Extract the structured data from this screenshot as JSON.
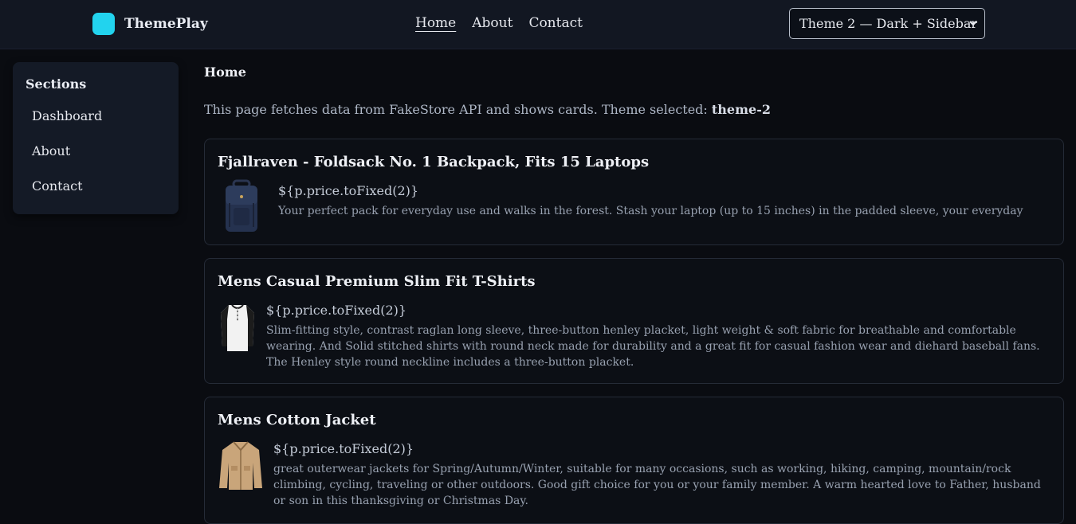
{
  "brand": {
    "name": "ThemePlay",
    "logo_color": "#22d3ee"
  },
  "nav": {
    "home": "Home",
    "about": "About",
    "contact": "Contact"
  },
  "theme_select": {
    "selected": "Theme 2 — Dark + Sidebar",
    "icon": "chevron-down-icon"
  },
  "sidebar": {
    "title": "Sections",
    "items": [
      {
        "label": "Dashboard"
      },
      {
        "label": "About"
      },
      {
        "label": "Contact"
      }
    ]
  },
  "main": {
    "title": "Home",
    "intro_text": "This page fetches data from FakeStore API and shows cards. Theme selected: ",
    "intro_theme": "theme-2"
  },
  "products": [
    {
      "title": "Fjallraven - Foldsack No. 1 Backpack, Fits 15 Laptops",
      "price": "${p.price.toFixed(2)}",
      "description": "Your perfect pack for everyday use and walks in the forest. Stash your laptop (up to 15 inches) in the padded sleeve, your everyday",
      "image": "backpack-image"
    },
    {
      "title": "Mens Casual Premium Slim Fit T-Shirts",
      "price": "${p.price.toFixed(2)}",
      "description": "Slim-fitting style, contrast raglan long sleeve, three-button henley placket, light weight & soft fabric for breathable and comfortable wearing. And Solid stitched shirts with round neck made for durability and a great fit for casual fashion wear and diehard baseball fans. The Henley style round neckline includes a three-button placket.",
      "image": "tshirt-image"
    },
    {
      "title": "Mens Cotton Jacket",
      "price": "${p.price.toFixed(2)}",
      "description": "great outerwear jackets for Spring/Autumn/Winter, suitable for many occasions, such as working, hiking, camping, mountain/rock climbing, cycling, traveling or other outdoors. Good gift choice for you or your family member. A warm hearted love to Father, husband or son in this thanksgiving or Christmas Day.",
      "image": "jacket-image"
    }
  ]
}
